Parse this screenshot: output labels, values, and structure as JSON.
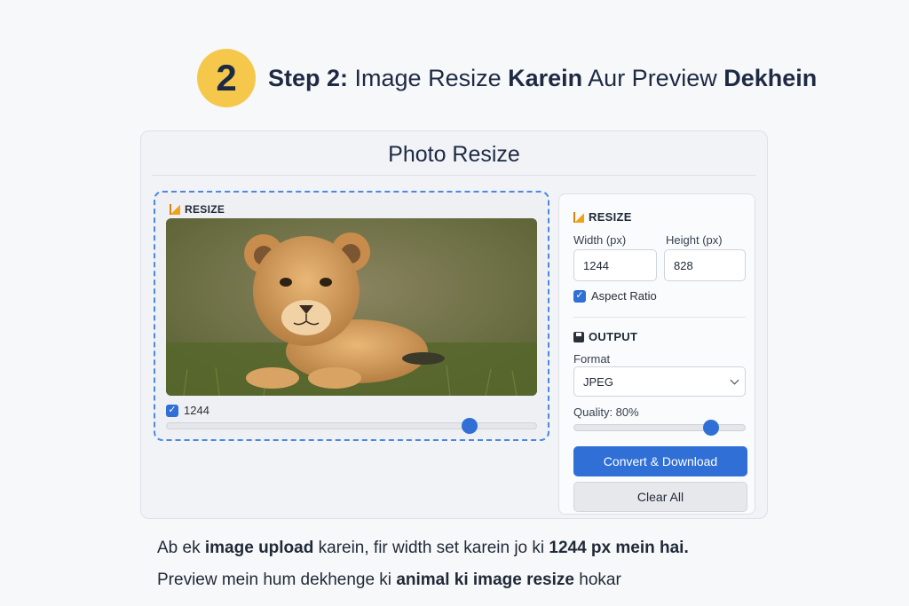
{
  "step": {
    "number": "2",
    "title_bold": "Step 2:",
    "title_part1": " Image Resize ",
    "title_bold2": "Karein",
    "title_part2": " Aur Preview ",
    "title_bold3": "Dekhein"
  },
  "app": {
    "title": "Photo Resize",
    "preview": {
      "section_label": "RESIZE",
      "image_icon": "lion-cub-photo",
      "checkbox_label": "1244",
      "checkbox_checked": true,
      "slider_level": 0.82
    },
    "settings": {
      "resize_label": "RESIZE",
      "width_label": "Width (px)",
      "height_label": "Height (px)",
      "width_value": "1244",
      "height_value": "828",
      "aspect_label": "Aspect Ratio",
      "aspect_checked": true,
      "output_label": "OUTPUT",
      "format_label": "Format",
      "format_value": "JPEG",
      "quality_label": "Quality: 80%",
      "quality_level": 0.8,
      "convert_label": "Convert & Download",
      "clear_label": "Clear All"
    },
    "accent_color": "#2f6fd6",
    "badge_color": "#f5c84b"
  },
  "caption": {
    "line1_a": "Ab ek ",
    "line1_b": "image upload",
    "line1_c": " karein, fir width set karein jo ki ",
    "line1_d": "1244 px mein hai.",
    "line2_a": "Preview mein hum dekhenge ki ",
    "line2_b": "animal ki image resize",
    "line2_c": " hokar"
  }
}
